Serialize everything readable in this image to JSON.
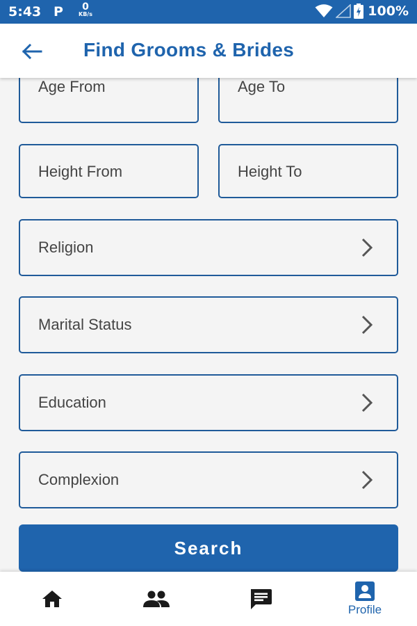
{
  "status_bar": {
    "time": "5:43",
    "p_icon": "P",
    "net_speed_value": "0",
    "net_speed_unit": "KB/s",
    "battery_percent": "100%",
    "icons": [
      "parking-icon",
      "wifi-icon",
      "signal-icon",
      "battery-icon"
    ]
  },
  "header": {
    "title": "Find Grooms & Brides",
    "back_icon": "arrow-left-icon"
  },
  "form": {
    "age_from_label": "Age From",
    "age_to_label": "Age To",
    "height_from_label": "Height From",
    "height_to_label": "Height To",
    "selectors": [
      {
        "label": "Religion",
        "icon": "chevron-right-icon"
      },
      {
        "label": "Marital Status",
        "icon": "chevron-right-icon"
      },
      {
        "label": "Education",
        "icon": "chevron-right-icon"
      },
      {
        "label": "Complexion",
        "icon": "chevron-right-icon"
      }
    ],
    "search_label": "Search"
  },
  "bottom_nav": {
    "items": [
      {
        "name": "home",
        "icon": "home-icon",
        "label": ""
      },
      {
        "name": "people",
        "icon": "people-icon",
        "label": ""
      },
      {
        "name": "messages",
        "icon": "message-icon",
        "label": ""
      },
      {
        "name": "profile",
        "icon": "profile-icon",
        "label": "Profile",
        "active": true
      }
    ]
  },
  "colors": {
    "primary": "#1f64ad",
    "field_border": "#1f5a99",
    "background": "#f4f4f4",
    "label_text": "#444444"
  }
}
